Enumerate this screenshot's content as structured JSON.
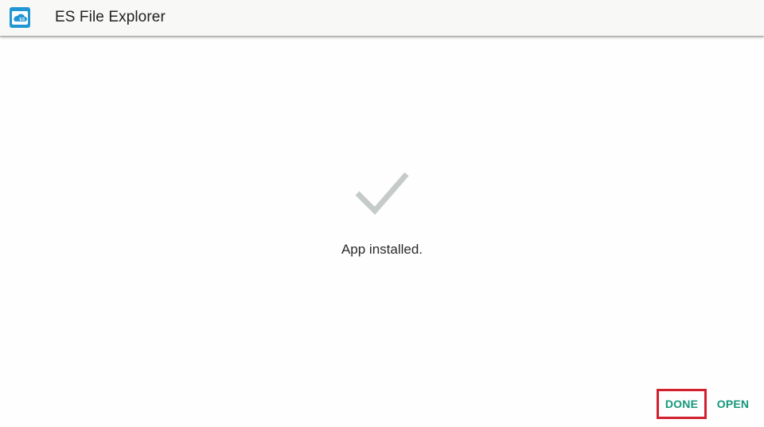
{
  "app_bar": {
    "title": "ES File Explorer",
    "icon": "es-file-explorer-app-icon"
  },
  "status": {
    "icon": "checkmark-icon",
    "message": "App installed."
  },
  "actions": {
    "done_label": "DONE",
    "open_label": "OPEN"
  },
  "colors": {
    "accent": "#16977b",
    "highlight_border": "#d3202e",
    "checkmark": "#c5cbc9",
    "app_icon": "#2196d3"
  }
}
